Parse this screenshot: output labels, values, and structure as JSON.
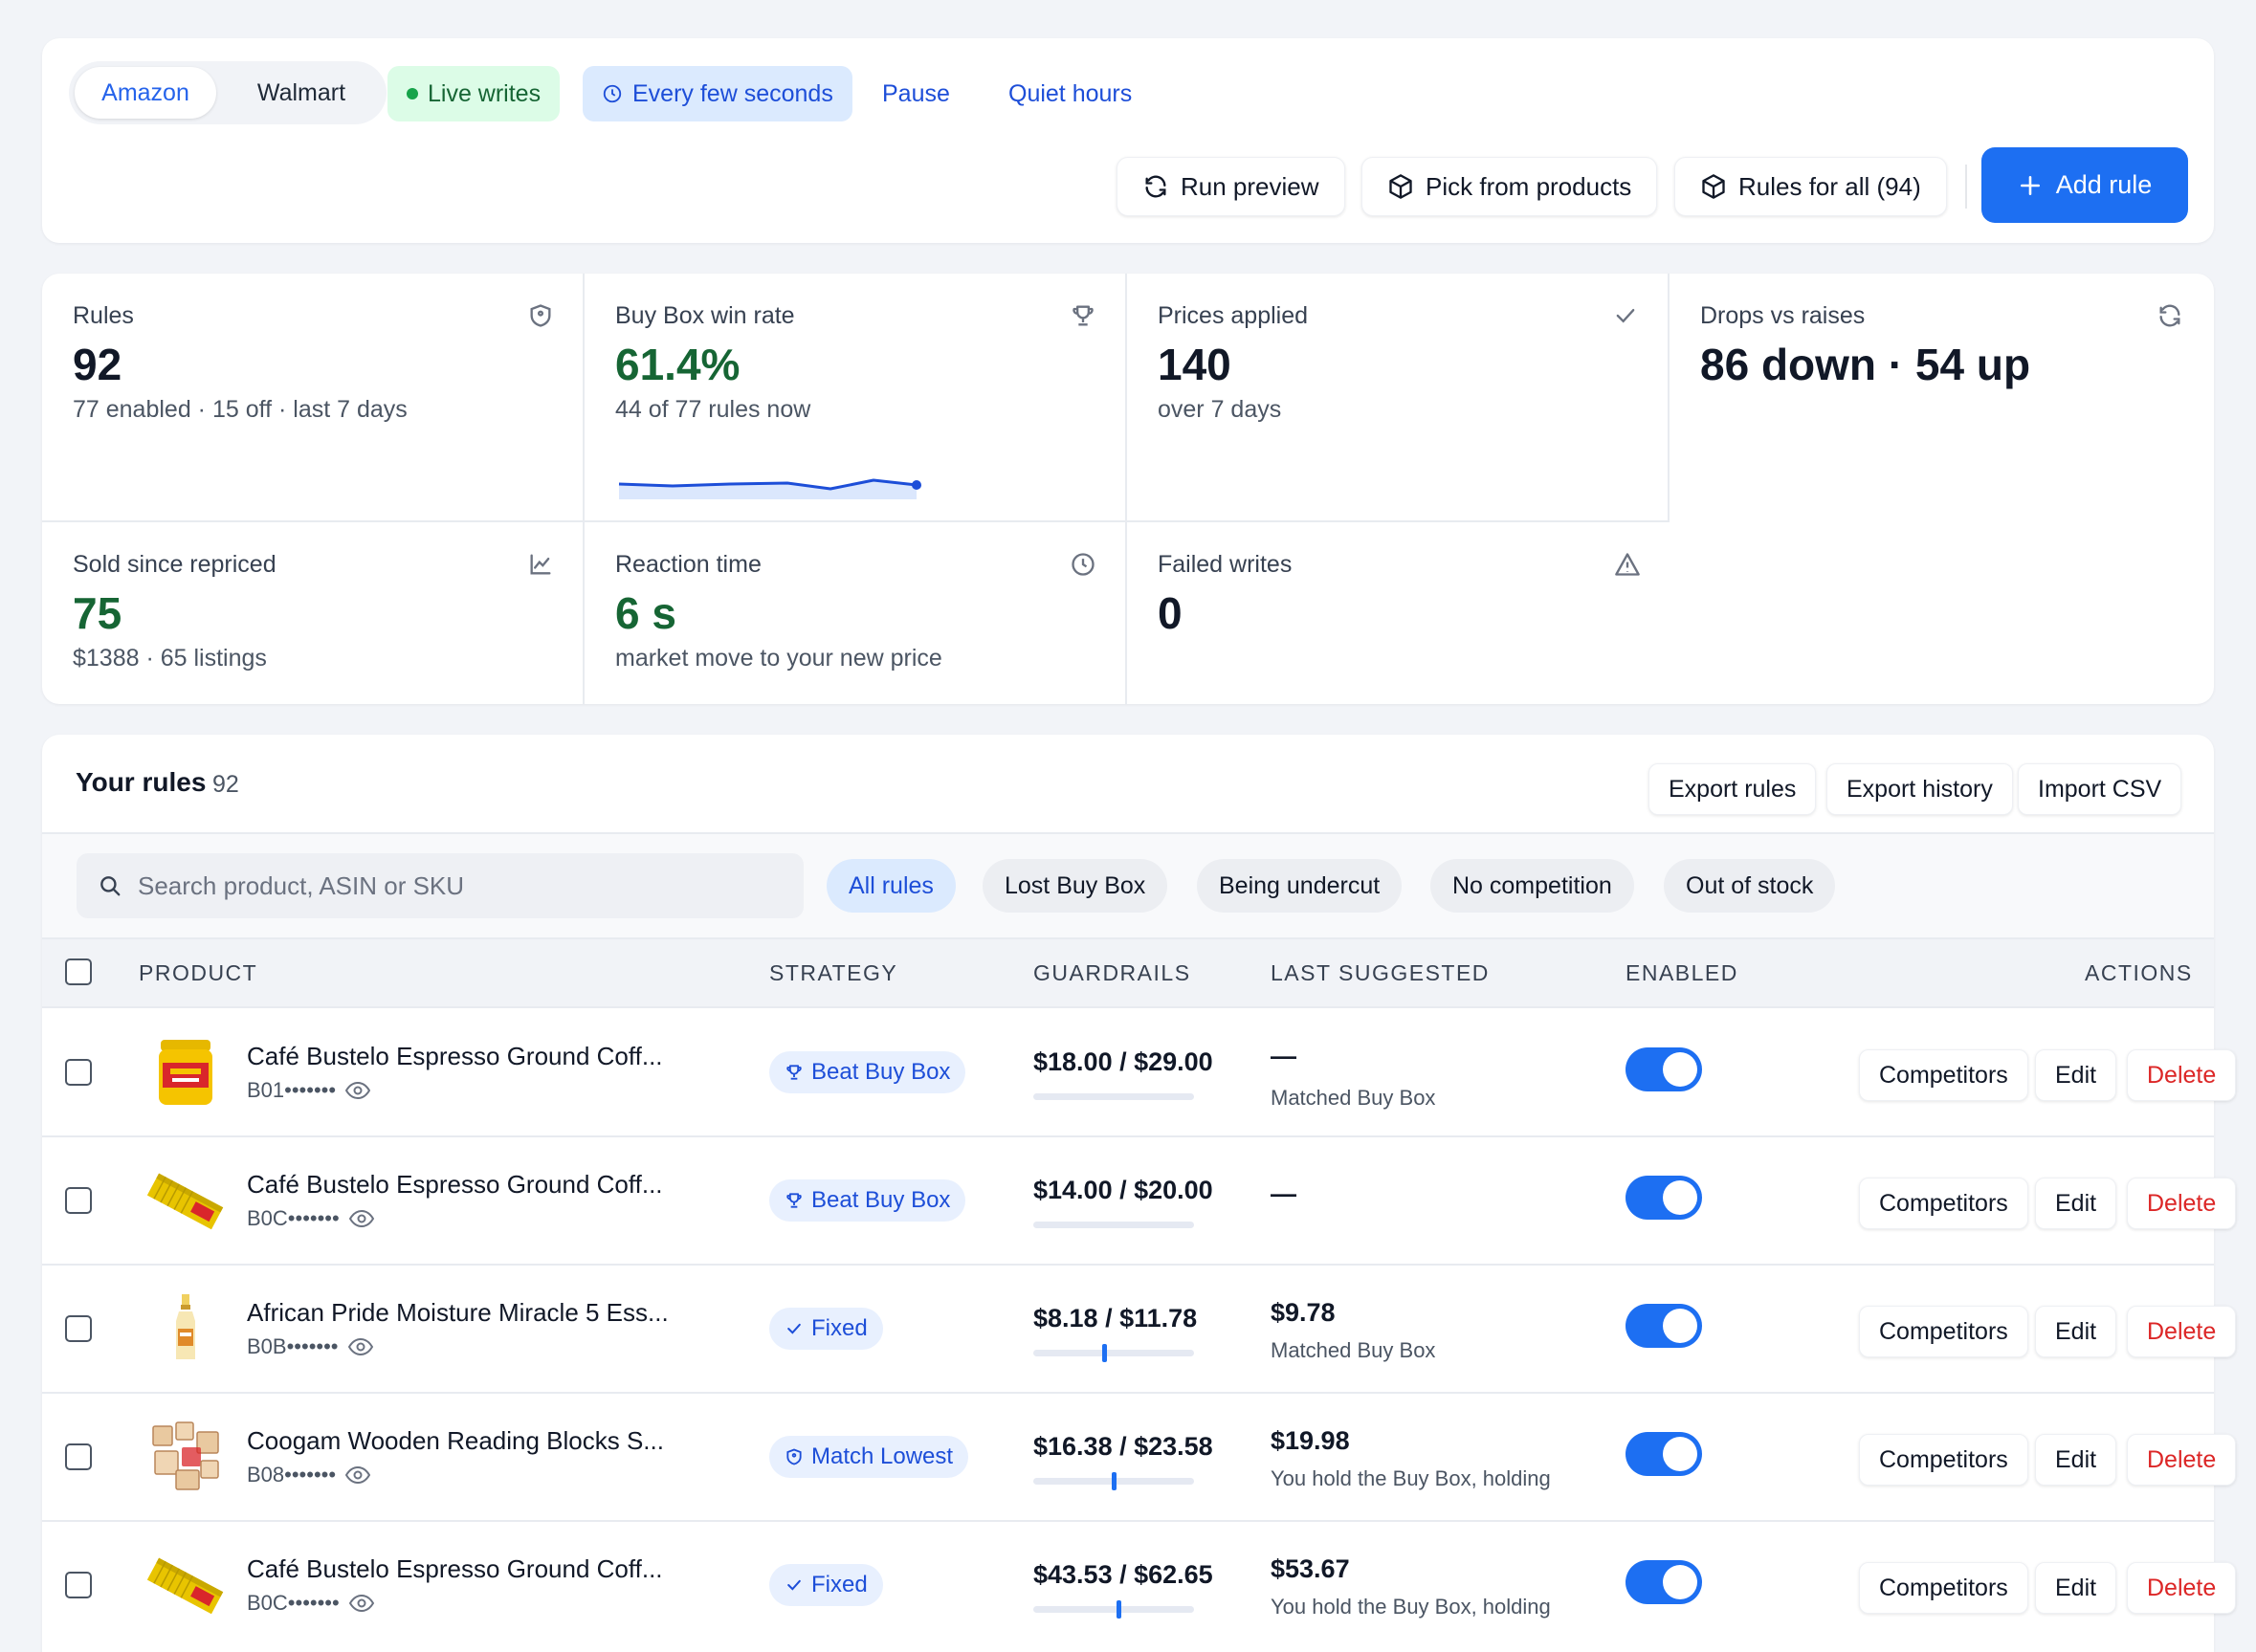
{
  "toolbar": {
    "marketplaces": [
      "Amazon",
      "Walmart"
    ],
    "live_label": "Live writes",
    "frequency_label": "Every few seconds",
    "pause_label": "Pause",
    "quiet_hours_label": "Quiet hours",
    "run_preview_label": "Run preview",
    "pick_products_label": "Pick from products",
    "rules_for_all_label": "Rules for all (94)",
    "add_rule_label": "Add rule",
    "accent_color": "#1d6ff2"
  },
  "stats": [
    {
      "label": "Rules",
      "value": "92",
      "sub": "77 enabled · 15 off · last 7 days",
      "icon": "tag-icon"
    },
    {
      "label": "Buy Box win rate",
      "value": "61.4%",
      "sub": "44 of 77 rules now",
      "icon": "trophy-icon"
    },
    {
      "label": "Prices applied",
      "value": "140",
      "sub": "over 7 days",
      "icon": "check-icon"
    },
    {
      "label": "Drops vs raises",
      "value": "86 down · 54 up",
      "sub": "",
      "icon": "refresh-icon"
    },
    {
      "label": "Sold since repriced",
      "value": "75",
      "sub": "$1388 · 65 listings",
      "icon": "chart-icon"
    },
    {
      "label": "Reaction time",
      "value": "6 s",
      "sub": "market move to your new price",
      "icon": "clock-icon"
    },
    {
      "label": "Failed writes",
      "value": "0",
      "sub": "",
      "icon": "warning-icon"
    }
  ],
  "rules": {
    "title": "Your rules",
    "count": "92",
    "export_rules_label": "Export rules",
    "export_history_label": "Export history",
    "import_csv_label": "Import CSV",
    "search_placeholder": "Search product, ASIN or SKU",
    "filters": [
      "All rules",
      "Lost Buy Box",
      "Being undercut",
      "No competition",
      "Out of stock"
    ],
    "columns": [
      "PRODUCT",
      "STRATEGY",
      "GUARDRAILS",
      "LAST SUGGESTED",
      "ENABLED",
      "ACTIONS"
    ],
    "row_actions": {
      "competitors": "Competitors",
      "edit": "Edit",
      "delete": "Delete"
    },
    "rows": [
      {
        "product": "Café Bustelo Espresso Ground Coff...",
        "asin": "B01•••••••",
        "strategy": "Beat Buy Box",
        "strategy_icon": "trophy-icon",
        "guardrails": "$18.00 / $29.00",
        "last_value": "—",
        "last_note": "Matched Buy Box",
        "enabled": true,
        "guard_position": null
      },
      {
        "product": "Café Bustelo Espresso Ground Coff...",
        "asin": "B0C•••••••",
        "strategy": "Beat Buy Box",
        "strategy_icon": "trophy-icon",
        "guardrails": "$14.00 / $20.00",
        "last_value": "—",
        "last_note": "",
        "enabled": true,
        "guard_position": null
      },
      {
        "product": "African Pride Moisture Miracle 5 Ess...",
        "asin": "B0B•••••••",
        "strategy": "Fixed",
        "strategy_icon": "check-icon",
        "guardrails": "$8.18 / $11.78",
        "last_value": "$9.78",
        "last_note": "Matched Buy Box",
        "enabled": true,
        "guard_position": 0.44
      },
      {
        "product": "Coogam Wooden Reading Blocks S...",
        "asin": "B08•••••••",
        "strategy": "Match Lowest",
        "strategy_icon": "tag-icon",
        "guardrails": "$16.38 / $23.58",
        "last_value": "$19.98",
        "last_note": "You hold the Buy Box, holding",
        "enabled": true,
        "guard_position": 0.5
      },
      {
        "product": "Café Bustelo Espresso Ground Coff...",
        "asin": "B0C•••••••",
        "strategy": "Fixed",
        "strategy_icon": "check-icon",
        "guardrails": "$43.53 / $62.65",
        "last_value": "$53.67",
        "last_note": "You hold the Buy Box, holding",
        "enabled": true,
        "guard_position": 0.53
      }
    ]
  }
}
